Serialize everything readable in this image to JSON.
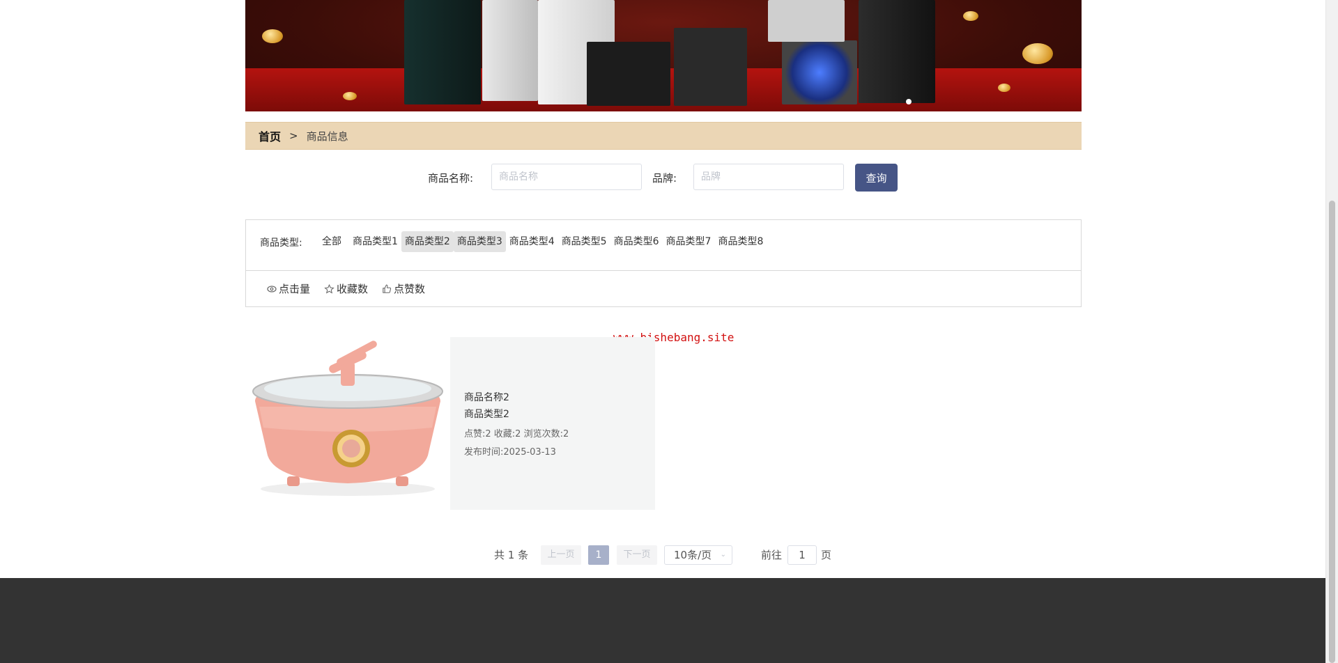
{
  "breadcrumb": {
    "home": "首页",
    "separator": ">",
    "current": "商品信息"
  },
  "search": {
    "name_label": "商品名称:",
    "name_placeholder": "商品名称",
    "brand_label": "品牌:",
    "brand_placeholder": "品牌",
    "button": "查询"
  },
  "filter": {
    "type_label": "商品类型:",
    "options": [
      "全部",
      "商品类型1",
      "商品类型2",
      "商品类型3",
      "商品类型4",
      "商品类型5",
      "商品类型6",
      "商品类型7",
      "商品类型8"
    ],
    "sorts": [
      {
        "label": "点击量",
        "icon": "eye-icon"
      },
      {
        "label": "收藏数",
        "icon": "star-icon"
      },
      {
        "label": "点赞数",
        "icon": "thumbs-up-icon"
      }
    ]
  },
  "watermark": "www.bishebang.site",
  "products": [
    {
      "name": "商品名称2",
      "type": "商品类型2",
      "stats": "点赞:2  收藏:2  浏览次数:2",
      "time": "发布时间:2025-03-13"
    }
  ],
  "pagination": {
    "total": "共 1 条",
    "prev": "上一页",
    "current": "1",
    "next": "下一页",
    "page_size": "10条/页",
    "goto_label": "前往",
    "goto_value": "1",
    "goto_suffix": "页"
  },
  "colors": {
    "accent": "#465586",
    "breadcrumb_bg": "#ebd6b5",
    "footer_bg": "#333333",
    "watermark": "#d21010"
  }
}
